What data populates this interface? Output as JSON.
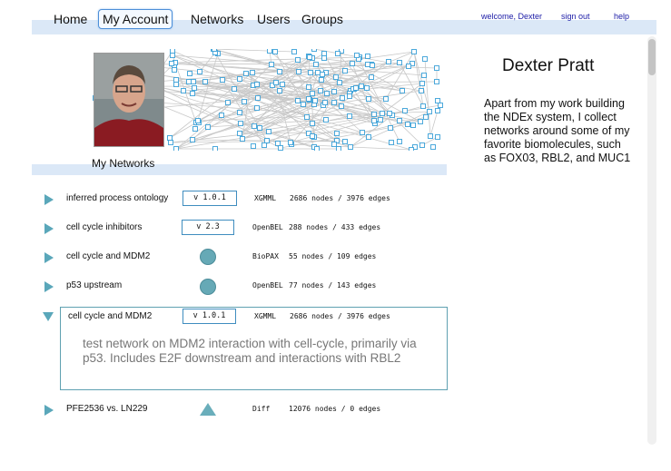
{
  "nav": {
    "items": [
      "Home",
      "My Account",
      "Networks",
      "Users",
      "Groups"
    ],
    "welcome": "welcome, Dexter",
    "sign_out": "sign out",
    "help": "help"
  },
  "section_title": "My Networks",
  "profile": {
    "name": "Dexter Pratt",
    "bio": "Apart from my work building the NDEx system, I collect networks around some of my favorite biomolecules, such as FOX03, RBL2, and MUC1"
  },
  "networks": [
    {
      "name": "inferred process ontology",
      "version": "v 1.0.1",
      "format": "XGMML",
      "stats": "2686 nodes / 3976 edges",
      "marker": "version"
    },
    {
      "name": "cell cycle inhibitors",
      "version": "v 2.3",
      "format": "OpenBEL",
      "stats": "288 nodes / 433 edges",
      "marker": "version"
    },
    {
      "name": "cell cycle and MDM2",
      "version": "",
      "format": "BioPAX",
      "stats": "55 nodes / 109 edges",
      "marker": "circle"
    },
    {
      "name": "p53 upstream",
      "version": "",
      "format": "OpenBEL",
      "stats": "77 nodes / 143 edges",
      "marker": "circle"
    },
    {
      "name": "cell cycle and MDM2",
      "version": "v 1.0.1",
      "format": "XGMML",
      "stats": "2686 nodes / 3976 edges",
      "marker": "version",
      "expanded": true,
      "description": "test network on MDM2 interaction with cell-cycle, primarily via p53. Includes E2F downstream and interactions with RBL2"
    },
    {
      "name": "PFE2536 vs. LN229",
      "version": "",
      "format": "Diff",
      "stats": "12076 nodes / 0 edges",
      "marker": "triangle"
    }
  ],
  "colors": {
    "nav_band": "#dbe8f7",
    "accent": "#5aa7ba",
    "version_border": "#3f8dbf",
    "link": "#1a1aa6"
  }
}
